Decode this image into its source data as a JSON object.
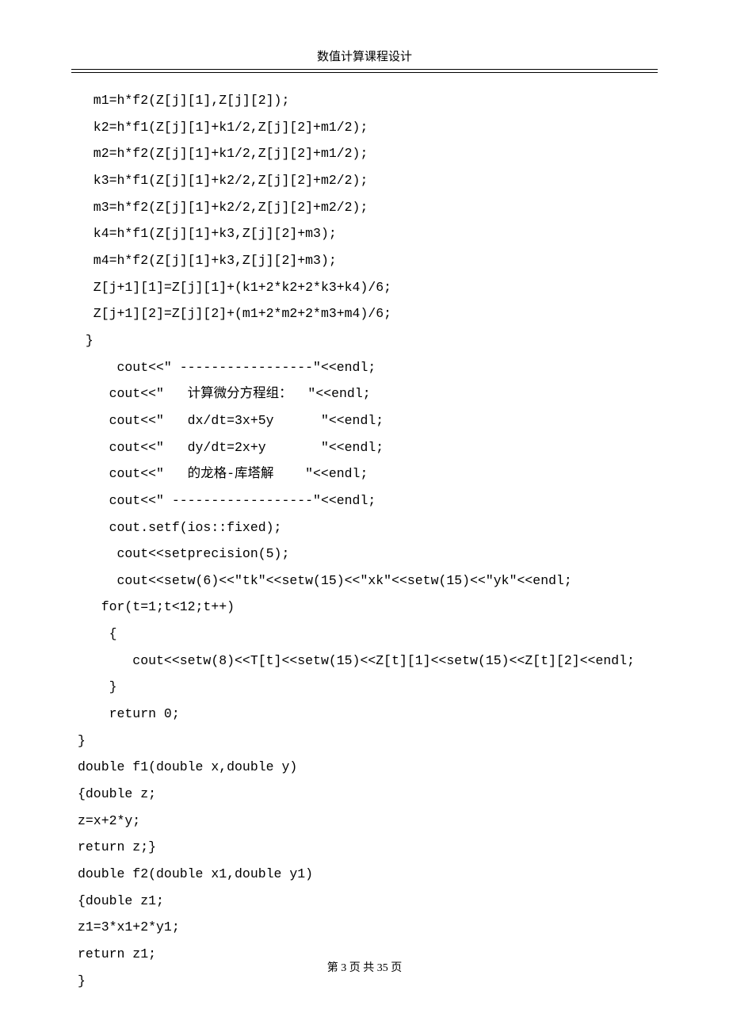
{
  "header": {
    "title": "数值计算课程设计"
  },
  "code": {
    "lines": [
      "  m1=h*f2(Z[j][1],Z[j][2]);",
      "  k2=h*f1(Z[j][1]+k1/2,Z[j][2]+m1/2);",
      "  m2=h*f2(Z[j][1]+k1/2,Z[j][2]+m1/2);",
      "  k3=h*f1(Z[j][1]+k2/2,Z[j][2]+m2/2);",
      "  m3=h*f2(Z[j][1]+k2/2,Z[j][2]+m2/2);",
      "  k4=h*f1(Z[j][1]+k3,Z[j][2]+m3);",
      "  m4=h*f2(Z[j][1]+k3,Z[j][2]+m3);",
      "  Z[j+1][1]=Z[j][1]+(k1+2*k2+2*k3+k4)/6;",
      "  Z[j+1][2]=Z[j][2]+(m1+2*m2+2*m3+m4)/6;",
      " }",
      "     cout<<\" -----------------\"<<endl;",
      "    cout<<\"   计算微分方程组：  \"<<endl;",
      "    cout<<\"   dx/dt=3x+5y      \"<<endl;",
      "    cout<<\"   dy/dt=2x+y       \"<<endl;",
      "    cout<<\"   的龙格-库塔解    \"<<endl;",
      "    cout<<\" ------------------\"<<endl;",
      "    cout.setf(ios::fixed);",
      "     cout<<setprecision(5);",
      "     cout<<setw(6)<<\"tk\"<<setw(15)<<\"xk\"<<setw(15)<<\"yk\"<<endl;",
      "   for(t=1;t<12;t++)",
      "    {",
      "       cout<<setw(8)<<T[t]<<setw(15)<<Z[t][1]<<setw(15)<<Z[t][2]<<endl;",
      "    }",
      "    return 0;",
      "}",
      "double f1(double x,double y)",
      "{double z;",
      "z=x+2*y;",
      "return z;}",
      "double f2(double x1,double y1)",
      "{double z1;",
      "z1=3*x1+2*y1;",
      "return z1;",
      "}"
    ]
  },
  "footer": {
    "text": "第 3 页 共 35 页"
  }
}
